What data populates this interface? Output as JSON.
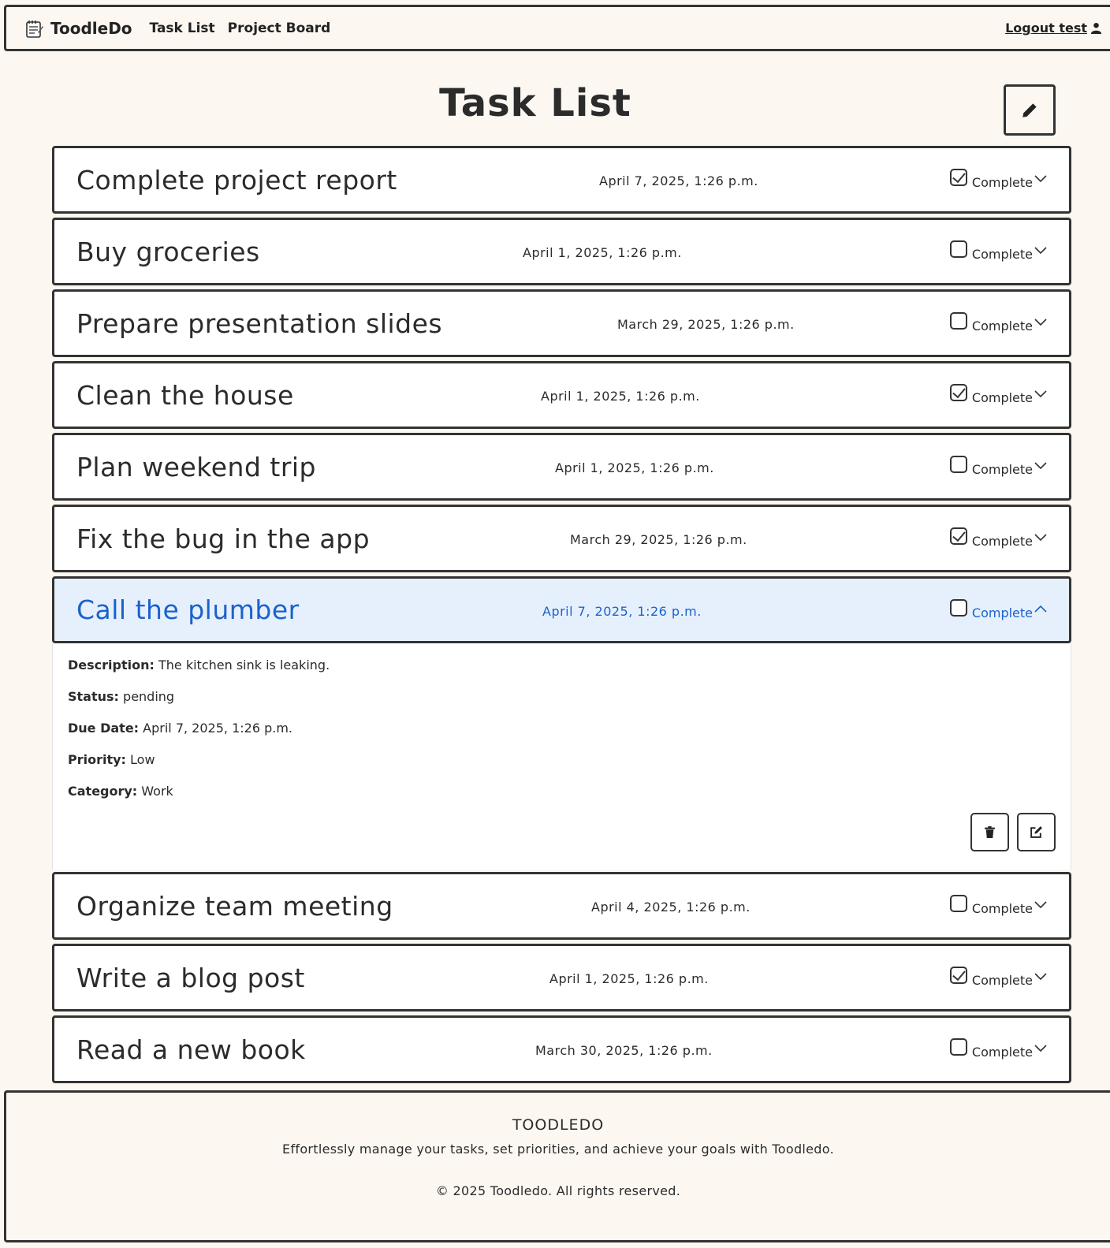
{
  "navbar": {
    "brand": "ToodleDo",
    "links": [
      "Task List",
      "Project Board"
    ],
    "logout": "Logout test"
  },
  "page": {
    "title": "Task List"
  },
  "tasks": [
    {
      "title": "Complete project report",
      "date": "April 7, 2025, 1:26 p.m.",
      "complete": true,
      "complete_label": "Complete"
    },
    {
      "title": "Buy groceries",
      "date": "April 1, 2025, 1:26 p.m.",
      "complete": false,
      "complete_label": "Complete"
    },
    {
      "title": "Prepare presentation slides",
      "date": "March 29, 2025, 1:26 p.m.",
      "complete": false,
      "complete_label": "Complete"
    },
    {
      "title": "Clean the house",
      "date": "April 1, 2025, 1:26 p.m.",
      "complete": true,
      "complete_label": "Complete"
    },
    {
      "title": "Plan weekend trip",
      "date": "April 1, 2025, 1:26 p.m.",
      "complete": false,
      "complete_label": "Complete"
    },
    {
      "title": "Fix the bug in the app",
      "date": "March 29, 2025, 1:26 p.m.",
      "complete": true,
      "complete_label": "Complete"
    },
    {
      "title": "Call the plumber",
      "date": "April 7, 2025, 1:26 p.m.",
      "complete": false,
      "complete_label": "Complete",
      "expanded": true
    },
    {
      "title": "Organize team meeting",
      "date": "April 4, 2025, 1:26 p.m.",
      "complete": false,
      "complete_label": "Complete"
    },
    {
      "title": "Write a blog post",
      "date": "April 1, 2025, 1:26 p.m.",
      "complete": true,
      "complete_label": "Complete"
    },
    {
      "title": "Read a new book",
      "date": "March 30, 2025, 1:26 p.m.",
      "complete": false,
      "complete_label": "Complete"
    }
  ],
  "details": {
    "description_label": "Description:",
    "description": "The kitchen sink is leaking.",
    "status_label": "Status:",
    "status": "pending",
    "due_label": "Due Date:",
    "due": "April 7, 2025, 1:26 p.m.",
    "priority_label": "Priority:",
    "priority": "Low",
    "category_label": "Category:",
    "category": "Work"
  },
  "footer": {
    "title": "TOODLEDO",
    "tagline": "Effortlessly manage your tasks, set priorities, and achieve your goals with Toodledo.",
    "copyright": "© 2025 Toodledo. All rights reserved."
  },
  "colors": {
    "background": "#fcf7f1",
    "accent": "#1a62cc",
    "expanded_bg": "#e6f0fc",
    "border": "#333333"
  },
  "icons": {
    "brand": "notepad-icon",
    "logout": "user-icon",
    "new_task": "pencil-icon",
    "delete": "trash-icon",
    "edit": "edit-icon",
    "row_toggle": "chevron-icon"
  }
}
